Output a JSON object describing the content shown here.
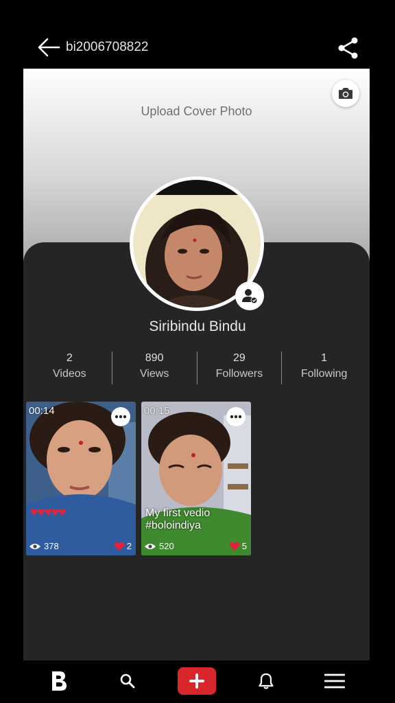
{
  "header": {
    "username": "bi2006708822",
    "back_icon": "arrow-left-icon",
    "share_icon": "share-icon"
  },
  "cover": {
    "upload_label": "Upload Cover Photo",
    "camera_icon": "camera-icon"
  },
  "profile": {
    "display_name": "Siribindu Bindu",
    "follow_icon": "user-add-icon"
  },
  "stats": [
    {
      "value": "2",
      "label": "Videos"
    },
    {
      "value": "890",
      "label": "Views"
    },
    {
      "value": "29",
      "label": "Followers"
    },
    {
      "value": "1",
      "label": "Following"
    }
  ],
  "videos": [
    {
      "duration": "00:14",
      "caption_line1": "",
      "caption_line2": "",
      "hearts": "♥♥♥♥♥",
      "views": "378",
      "likes": "2"
    },
    {
      "duration": "00:15",
      "caption_line1": "My first vedio",
      "caption_line2": "#boloindiya",
      "hearts": "",
      "views": "520",
      "likes": "5"
    }
  ],
  "nav": {
    "items": [
      "home-logo-icon",
      "search-icon",
      "add-icon",
      "bell-icon",
      "menu-icon"
    ]
  },
  "colors": {
    "background": "#000000",
    "panel": "#252525",
    "accent": "#d7262c",
    "heart": "#e2233b"
  }
}
